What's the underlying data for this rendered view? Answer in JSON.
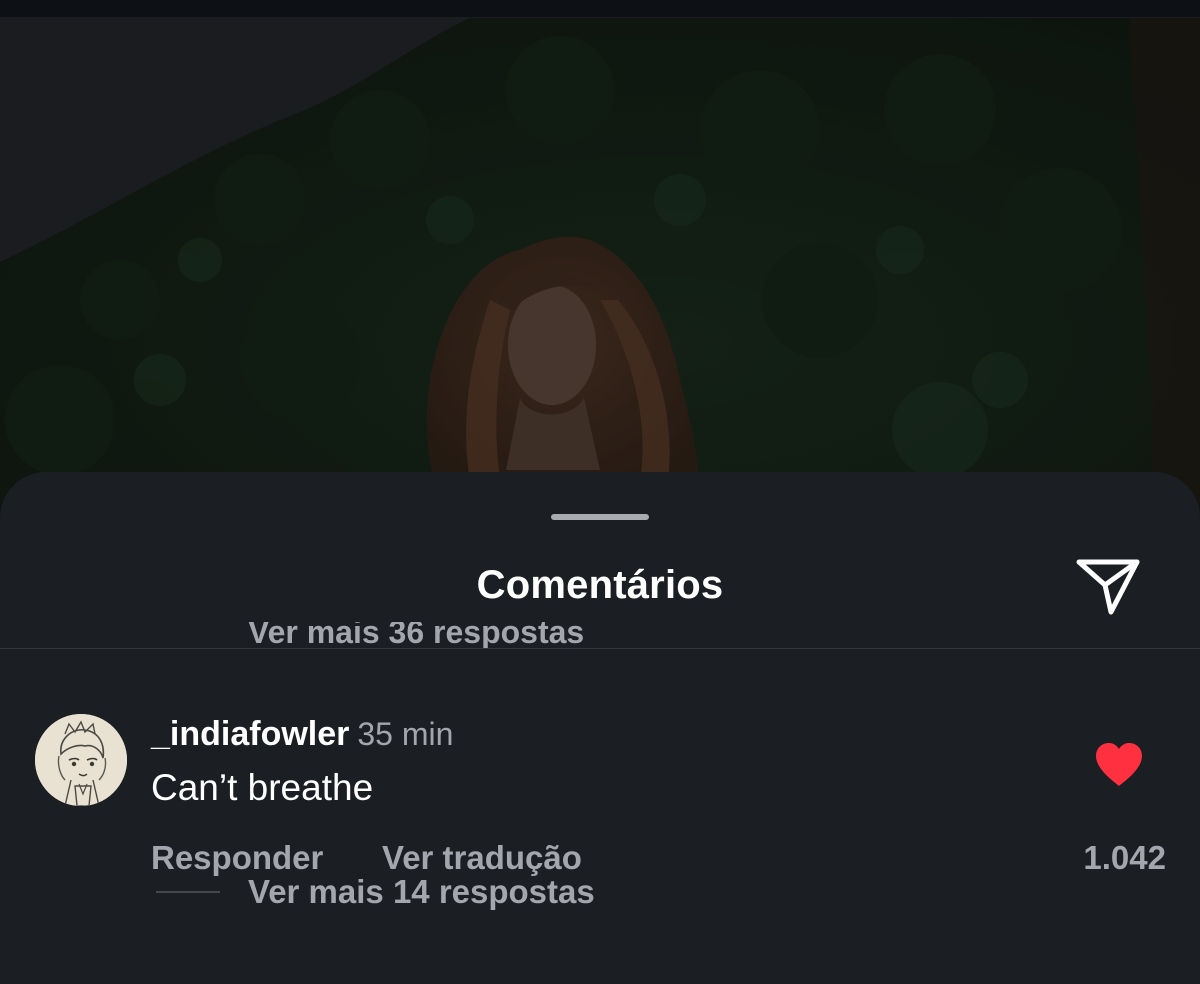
{
  "sheet": {
    "title": "Comentários",
    "share_icon": "send-paper-plane-icon"
  },
  "previous_thread": {
    "more_replies": "Ver mais 36 respostas"
  },
  "comment": {
    "username": "_indiafowler",
    "time": "35 min",
    "text": "Can’t breathe",
    "reply_label": "Responder",
    "translate_label": "Ver tradução",
    "like_icon": "heart-filled-icon",
    "like_count": "1.042",
    "more_replies": "Ver mais 14 respostas"
  },
  "colors": {
    "sheet_background": "#1b1f23",
    "like_red": "#ff3040",
    "secondary_text": "#a3a7ad"
  }
}
